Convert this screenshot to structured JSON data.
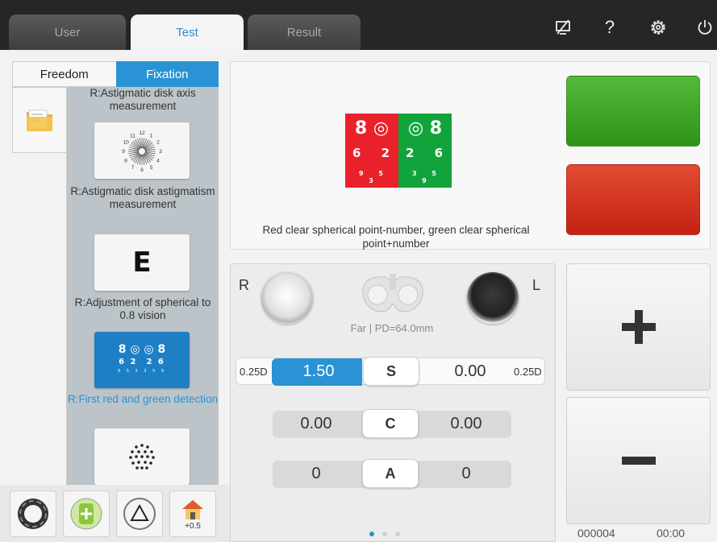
{
  "tabs": [
    {
      "label": "User"
    },
    {
      "label": "Test"
    },
    {
      "label": "Result"
    }
  ],
  "top_icons": [
    "screen-off-icon",
    "help-icon",
    "settings-icon",
    "power-icon"
  ],
  "help_glyph": "?",
  "mode": {
    "freedom": "Freedom",
    "fixation": "Fixation"
  },
  "list": [
    {
      "label": "R:Astigmatic disk axis measurement",
      "icon": "clock-dial-icon"
    },
    {
      "label": "R:Astigmatic disk astigmatism measurement",
      "icon": "letter-e-icon",
      "glyph": "E"
    },
    {
      "label": "R:Adjustment of spherical to 0.8 vision",
      "icon": "red-green-chart-icon"
    },
    {
      "label": "R:First red and green detection",
      "icon": "dot-pattern-icon",
      "selected": true
    }
  ],
  "dial_numbers": [
    "11",
    "12",
    "1",
    "2",
    "3",
    "4",
    "5",
    "6",
    "7",
    "8",
    "9",
    "10"
  ],
  "rg_chart": {
    "red": {
      "row1": "8",
      "row2": "6 2",
      "row3": "9 5 3"
    },
    "green": {
      "row1": "8",
      "row2": "2 6",
      "row3": "3 5 9"
    }
  },
  "display": {
    "caption": "Red clear spherical point-number, green clear spherical point+number"
  },
  "bottom_tools": {
    "step_label": "+0.5"
  },
  "eyes": {
    "right": "R",
    "left": "L",
    "far_pd": "Far | PD=64.0mm"
  },
  "rows": {
    "s": {
      "step_left": "0.25D",
      "left": "1.50",
      "key": "S",
      "right": "0.00",
      "step_right": "0.25D"
    },
    "c": {
      "left": "0.00",
      "key": "C",
      "right": "0.00"
    },
    "a": {
      "left": "0",
      "key": "A",
      "right": "0"
    }
  },
  "footer": {
    "id": "000004",
    "time": "00:00"
  },
  "colors": {
    "accent": "#2a93d5",
    "green": "#3fa22a",
    "red": "#d93420"
  }
}
